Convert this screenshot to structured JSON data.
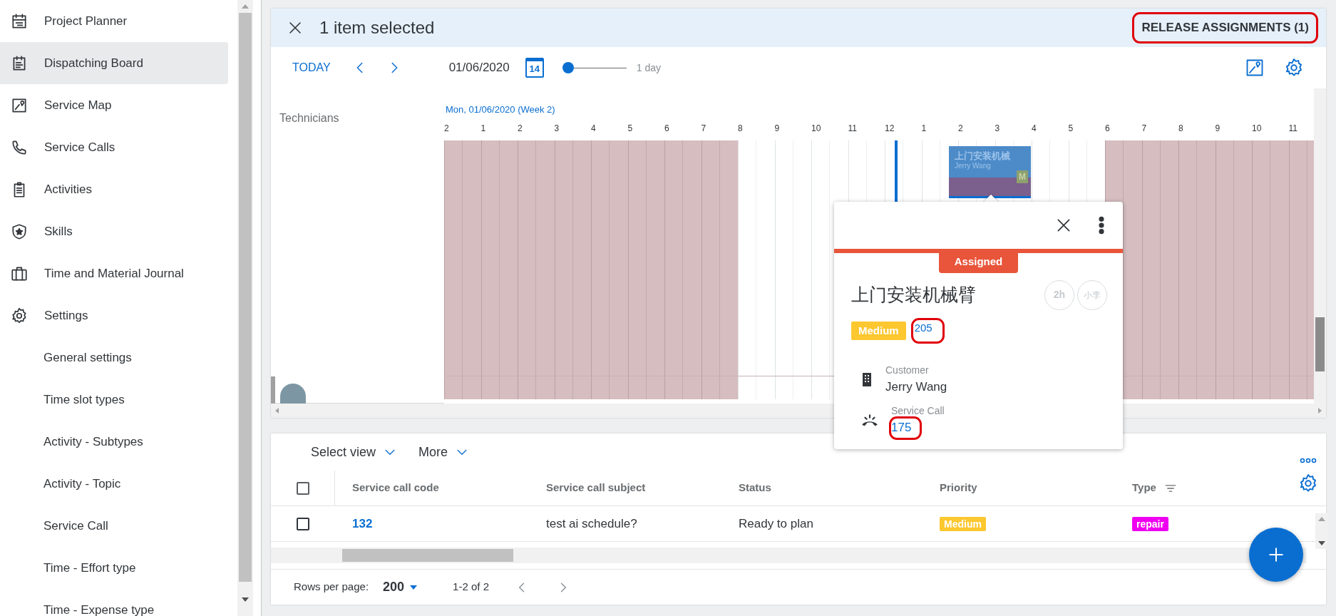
{
  "sidebar": {
    "items": [
      {
        "label": "Project Planner",
        "selected": false
      },
      {
        "label": "Dispatching Board",
        "selected": true
      },
      {
        "label": "Service Map",
        "selected": false
      },
      {
        "label": "Service Calls",
        "selected": false
      },
      {
        "label": "Activities",
        "selected": false
      },
      {
        "label": "Skills",
        "selected": false
      },
      {
        "label": "Time and Material Journal",
        "selected": false
      },
      {
        "label": "Settings",
        "selected": false,
        "children": [
          {
            "label": "General settings",
            "selected": false
          },
          {
            "label": "Time slot types",
            "selected": false
          },
          {
            "label": "Activity - Subtypes",
            "selected": false
          },
          {
            "label": "Activity - Topic",
            "selected": false
          },
          {
            "label": "Service Call",
            "selected": false
          },
          {
            "label": "Time - Effort type",
            "selected": false
          },
          {
            "label": "Time - Expense type",
            "selected": false
          }
        ]
      }
    ]
  },
  "selection_bar": {
    "text": "1 item selected",
    "action": "RELEASE ASSIGNMENTS (1)",
    "highlighted": true
  },
  "toolbar": {
    "today": "TODAY",
    "date": "01/06/2020",
    "calendar_day": "14",
    "zoom": {
      "level": 0,
      "reading": "1 day"
    }
  },
  "timeline": {
    "column_header": "Technicians",
    "date_label": "Mon, 01/06/2020 (Week 2)",
    "hours": [
      {
        "label": "2",
        "off_hours": true
      },
      {
        "label": "1",
        "off_hours": true
      },
      {
        "label": "2",
        "off_hours": true
      },
      {
        "label": "3",
        "off_hours": true
      },
      {
        "label": "4",
        "off_hours": true
      },
      {
        "label": "5",
        "off_hours": true
      },
      {
        "label": "6",
        "off_hours": true
      },
      {
        "label": "7",
        "off_hours": true
      },
      {
        "label": "8",
        "off_hours": false
      },
      {
        "label": "9",
        "off_hours": false
      },
      {
        "label": "10",
        "off_hours": false
      },
      {
        "label": "11",
        "off_hours": false
      },
      {
        "label": "12",
        "off_hours": false
      },
      {
        "label": "1",
        "off_hours": false
      },
      {
        "label": "2",
        "off_hours": false
      },
      {
        "label": "3",
        "off_hours": false
      },
      {
        "label": "4",
        "off_hours": false
      },
      {
        "label": "5",
        "off_hours": false
      },
      {
        "label": "6",
        "off_hours": true
      },
      {
        "label": "7",
        "off_hours": true
      },
      {
        "label": "8",
        "off_hours": true
      },
      {
        "label": "9",
        "off_hours": true
      },
      {
        "label": "10",
        "off_hours": true
      },
      {
        "label": "11",
        "off_hours": true
      }
    ],
    "event": {
      "title": "上门安装机械",
      "customer": "Jerry Wang",
      "badge": "M",
      "selected": true
    }
  },
  "popup": {
    "status": "Assigned",
    "title": "上门安装机械臂",
    "duration": "2h",
    "assignee": "小李",
    "priority": "Medium",
    "code": {
      "text": "205",
      "highlighted": true
    },
    "fields": [
      {
        "kind": "customer",
        "label": "Customer",
        "value": "Jerry Wang",
        "highlighted": false
      },
      {
        "kind": "service_call",
        "label": "Service Call",
        "value": "175",
        "highlighted": true
      }
    ]
  },
  "table": {
    "views": [
      "Select view",
      "More"
    ],
    "header_checked": false,
    "columns": [
      {
        "label": "Service call code",
        "filter": false
      },
      {
        "label": "Service call subject",
        "filter": false
      },
      {
        "label": "Status",
        "filter": false
      },
      {
        "label": "Priority",
        "filter": false
      },
      {
        "label": "Type",
        "filter": true
      }
    ],
    "rows": [
      {
        "checked": false,
        "code": "132",
        "subject": "test ai schedule?",
        "status": "Ready to plan",
        "priority": "Medium",
        "type": "repair"
      }
    ]
  },
  "pagination": {
    "label": "Rows per page:",
    "rows_per_page": "200",
    "range": "1-2 of 2"
  }
}
